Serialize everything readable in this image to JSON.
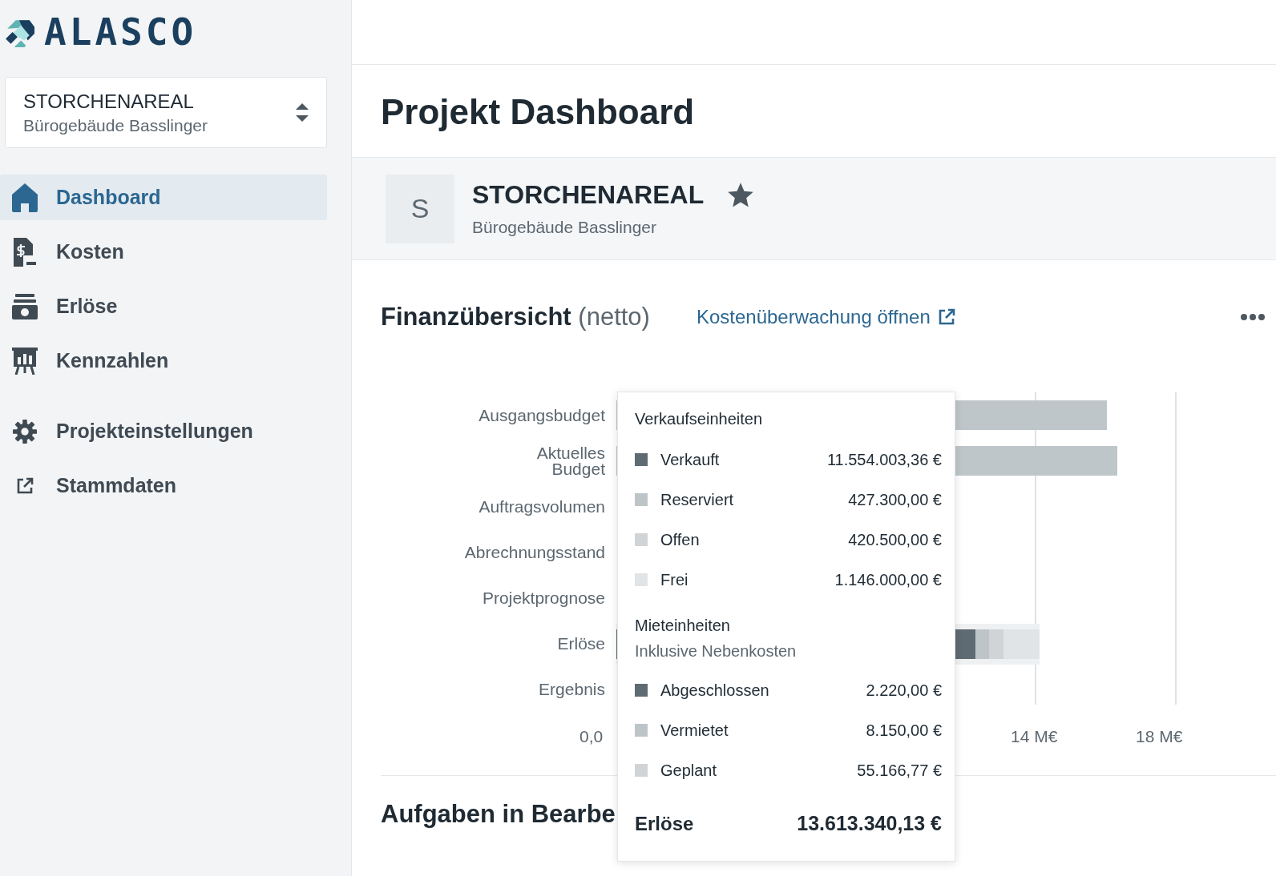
{
  "sidebar": {
    "logo": "ALASCO",
    "project_selector": {
      "title": "STORCHENAREAL",
      "subtitle": "Bürogebäude Basslinger"
    },
    "nav": [
      {
        "label": "Dashboard",
        "selected": true
      },
      {
        "label": "Kosten",
        "selected": false
      },
      {
        "label": "Erlöse",
        "selected": false
      },
      {
        "label": "Kennzahlen",
        "selected": false
      }
    ],
    "nav_secondary": [
      {
        "label": "Projekteinstellungen",
        "selected": false
      },
      {
        "label": "Stammdaten",
        "selected": false
      }
    ]
  },
  "page_title": "Projekt Dashboard",
  "project": {
    "avatar": "S",
    "name": "STORCHENAREAL",
    "subtitle": "Bürogebäude Basslinger",
    "favorite": true
  },
  "finance": {
    "title": "Finanzübersicht",
    "title_note": "(netto)",
    "link": "Kostenüberwachung öffnen",
    "chart": {
      "categories": [
        "Ausgangsbudget",
        "Aktuelles Budget",
        "Auftragsvolumen",
        "Abrechnungsstand",
        "Projektprognose",
        "Erlöse",
        "Ergebnis"
      ],
      "tick_labels": [
        "0,0",
        "14 M€",
        "18 M€"
      ]
    },
    "tooltip": {
      "sections": [
        {
          "title": "Verkaufseinheiten",
          "rows": [
            {
              "label": "Verkauft",
              "value": "11.554.003,36 €",
              "color": "#5f6b73"
            },
            {
              "label": "Reserviert",
              "value": "427.300,00 €",
              "color": "#bec5c8"
            },
            {
              "label": "Offen",
              "value": "420.500,00 €",
              "color": "#d0d4d7"
            },
            {
              "label": "Frei",
              "value": "1.146.000,00 €",
              "color": "#e1e4e7"
            }
          ]
        },
        {
          "title": "Mieteinheiten",
          "note": "Inklusive Nebenkosten",
          "rows": [
            {
              "label": "Abgeschlossen",
              "value": "2.220,00 €",
              "color": "#5f6b73"
            },
            {
              "label": "Vermietet",
              "value": "8.150,00 €",
              "color": "#bec5c8"
            },
            {
              "label": "Geplant",
              "value": "55.166,77 €",
              "color": "#d0d4d7"
            }
          ]
        }
      ],
      "total_label": "Erlöse",
      "total_value": "13.613.340,13 €"
    }
  },
  "tasks": {
    "title": "Aufgaben in Bearbe"
  }
}
